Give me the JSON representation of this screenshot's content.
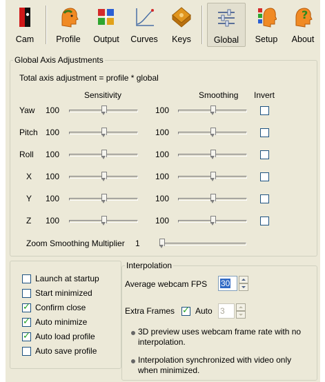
{
  "toolbar": {
    "buttons": [
      {
        "label": "Cam",
        "icon": "camera-icon"
      },
      {
        "label": "Profile",
        "icon": "profile-head-icon"
      },
      {
        "label": "Output",
        "icon": "output-arrows-icon"
      },
      {
        "label": "Curves",
        "icon": "curves-graph-icon"
      },
      {
        "label": "Keys",
        "icon": "keys-icon"
      },
      {
        "label": "Global",
        "icon": "global-sliders-icon",
        "active": true
      },
      {
        "label": "Setup",
        "icon": "setup-head-icon"
      },
      {
        "label": "About",
        "icon": "about-question-icon"
      }
    ]
  },
  "global_axis": {
    "title": "Global Axis Adjustments",
    "formula": "Total axis adjustment = profile * global",
    "sensitivity_header": "Sensitivity",
    "smoothing_header": "Smoothing",
    "invert_header": "Invert",
    "axes": [
      {
        "name": "Yaw",
        "sensitivity": "100",
        "smoothing": "100",
        "sens_pos": 0.5,
        "smooth_pos": 0.5,
        "invert": false
      },
      {
        "name": "Pitch",
        "sensitivity": "100",
        "smoothing": "100",
        "sens_pos": 0.5,
        "smooth_pos": 0.5,
        "invert": false
      },
      {
        "name": "Roll",
        "sensitivity": "100",
        "smoothing": "100",
        "sens_pos": 0.5,
        "smooth_pos": 0.5,
        "invert": false
      },
      {
        "name": "X",
        "sensitivity": "100",
        "smoothing": "100",
        "sens_pos": 0.5,
        "smooth_pos": 0.5,
        "invert": false
      },
      {
        "name": "Y",
        "sensitivity": "100",
        "smoothing": "100",
        "sens_pos": 0.5,
        "smooth_pos": 0.5,
        "invert": false
      },
      {
        "name": "Z",
        "sensitivity": "100",
        "smoothing": "100",
        "sens_pos": 0.5,
        "smooth_pos": 0.5,
        "invert": false
      }
    ],
    "zoom_label": "Zoom Smoothing Multiplier",
    "zoom_value": "1",
    "zoom_pos": 0.0
  },
  "options": {
    "items": [
      {
        "label": "Launch at startup",
        "checked": false
      },
      {
        "label": "Start minimized",
        "checked": false
      },
      {
        "label": "Confirm close",
        "checked": true
      },
      {
        "label": "Auto minimize",
        "checked": true
      },
      {
        "label": "Auto load profile",
        "checked": true
      },
      {
        "label": "Auto save profile",
        "checked": false
      }
    ]
  },
  "interpolation": {
    "title": "Interpolation",
    "fps_label": "Average webcam FPS",
    "fps_value": "30",
    "extra_frames_label": "Extra Frames",
    "auto_label": "Auto",
    "auto_checked": true,
    "extra_frames_value": "3",
    "notes": [
      "3D preview uses webcam frame rate with no interpolation.",
      "Interpolation synchronized with video only when minimized."
    ]
  },
  "colors": {
    "window_bg": "#ece9d8",
    "selection": "#316ac5",
    "check": "#21a121"
  }
}
